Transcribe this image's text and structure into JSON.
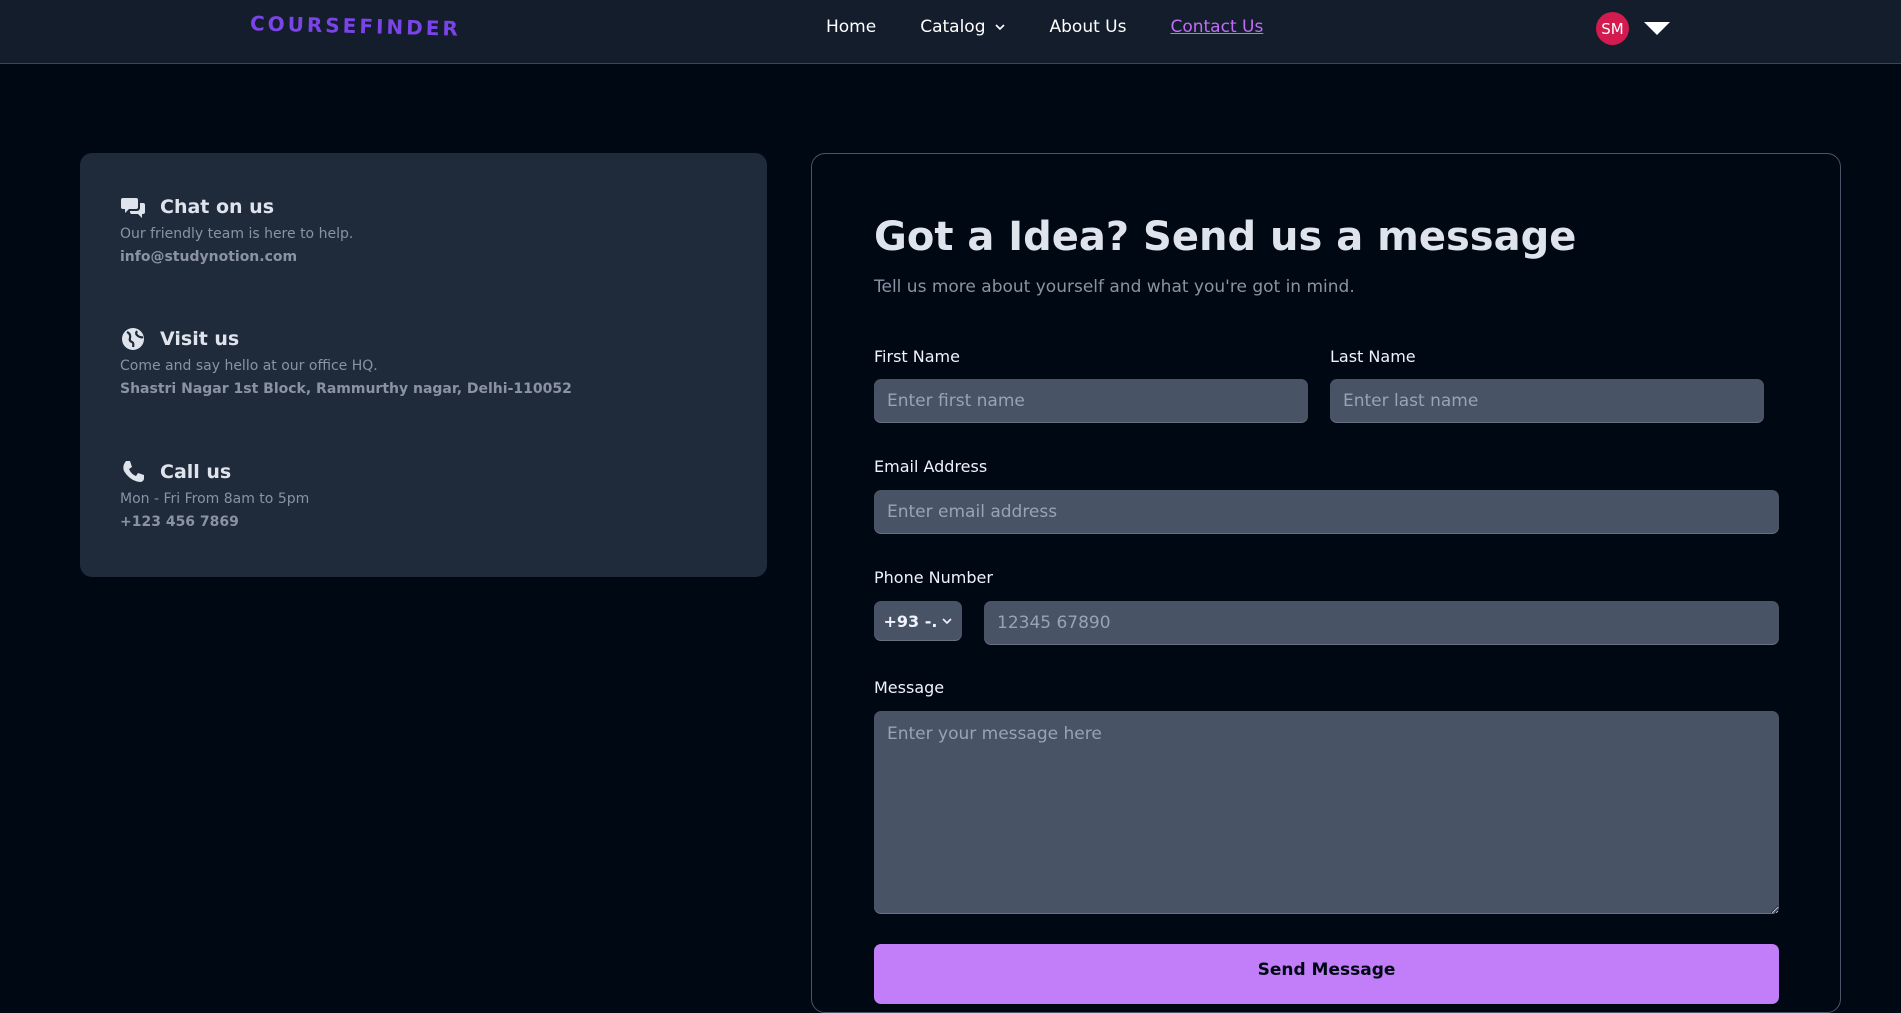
{
  "header": {
    "logo": "COURSEFINDER",
    "nav": [
      {
        "label": "Home",
        "active": false
      },
      {
        "label": "Catalog",
        "active": false
      },
      {
        "label": "About Us",
        "active": false
      },
      {
        "label": "Contact Us",
        "active": true
      }
    ],
    "avatar_initials": "SM",
    "icons": {
      "catalog_chevron": "chevron-down-icon",
      "profile_caret": "caret-down-icon"
    }
  },
  "contact_info": [
    {
      "icon": "chat-bubbles-icon",
      "title": "Chat on us",
      "description": "Our friendly team is here to help.",
      "detail": "info@studynotion.com"
    },
    {
      "icon": "globe-icon",
      "title": "Visit us",
      "description": "Come and say hello at our office HQ.",
      "detail": "Shastri Nagar 1st Block, Rammurthy nagar, Delhi-110052"
    },
    {
      "icon": "phone-icon",
      "title": "Call us",
      "description": "Mon - Fri From 8am to 5pm",
      "detail": "+123 456 7869"
    }
  ],
  "form": {
    "title": "Got a Idea? Send us a message",
    "subtitle": "Tell us more about yourself and what you're got in mind.",
    "first_name": {
      "label": "First Name",
      "placeholder": "Enter first name",
      "value": ""
    },
    "last_name": {
      "label": "Last Name",
      "placeholder": "Enter last name",
      "value": ""
    },
    "email": {
      "label": "Email Address",
      "placeholder": "Enter email address",
      "value": ""
    },
    "phone": {
      "label": "Phone Number",
      "country_code": "+93 -.",
      "placeholder": "12345 67890",
      "value": ""
    },
    "message": {
      "label": "Message",
      "placeholder": "Enter your message here",
      "value": ""
    },
    "submit_label": "Send Message"
  },
  "colors": {
    "background": "#000814",
    "header": "#131d2c",
    "accent": "#c17ef8",
    "logo": "#7b44e8",
    "avatar": "#d31b4f",
    "card": "#1f2a3a",
    "input": "#485365"
  }
}
